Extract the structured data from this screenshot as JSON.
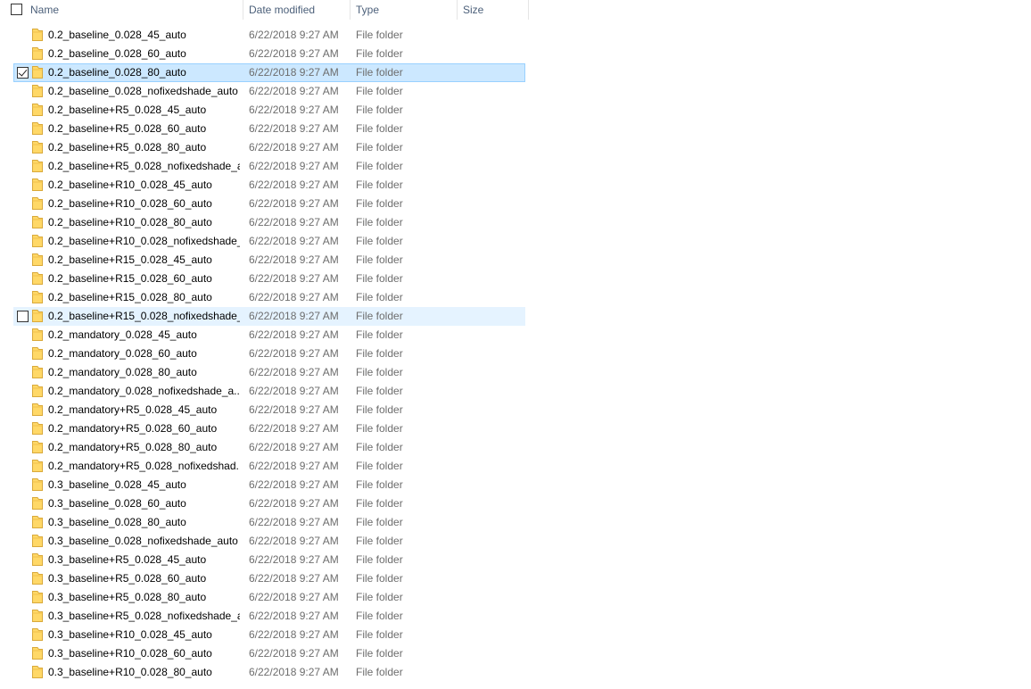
{
  "header": {
    "name_label": "Name",
    "date_label": "Date modified",
    "type_label": "Type",
    "size_label": "Size"
  },
  "rows": [
    {
      "name": "0.2_baseline_0.028_45_auto",
      "date": "6/22/2018 9:27 AM",
      "type": "File folder",
      "state": ""
    },
    {
      "name": "0.2_baseline_0.028_60_auto",
      "date": "6/22/2018 9:27 AM",
      "type": "File folder",
      "state": ""
    },
    {
      "name": "0.2_baseline_0.028_80_auto",
      "date": "6/22/2018 9:27 AM",
      "type": "File folder",
      "state": "selected"
    },
    {
      "name": "0.2_baseline_0.028_nofixedshade_auto",
      "date": "6/22/2018 9:27 AM",
      "type": "File folder",
      "state": ""
    },
    {
      "name": "0.2_baseline+R5_0.028_45_auto",
      "date": "6/22/2018 9:27 AM",
      "type": "File folder",
      "state": ""
    },
    {
      "name": "0.2_baseline+R5_0.028_60_auto",
      "date": "6/22/2018 9:27 AM",
      "type": "File folder",
      "state": ""
    },
    {
      "name": "0.2_baseline+R5_0.028_80_auto",
      "date": "6/22/2018 9:27 AM",
      "type": "File folder",
      "state": ""
    },
    {
      "name": "0.2_baseline+R5_0.028_nofixedshade_a...",
      "date": "6/22/2018 9:27 AM",
      "type": "File folder",
      "state": ""
    },
    {
      "name": "0.2_baseline+R10_0.028_45_auto",
      "date": "6/22/2018 9:27 AM",
      "type": "File folder",
      "state": ""
    },
    {
      "name": "0.2_baseline+R10_0.028_60_auto",
      "date": "6/22/2018 9:27 AM",
      "type": "File folder",
      "state": ""
    },
    {
      "name": "0.2_baseline+R10_0.028_80_auto",
      "date": "6/22/2018 9:27 AM",
      "type": "File folder",
      "state": ""
    },
    {
      "name": "0.2_baseline+R10_0.028_nofixedshade_...",
      "date": "6/22/2018 9:27 AM",
      "type": "File folder",
      "state": ""
    },
    {
      "name": "0.2_baseline+R15_0.028_45_auto",
      "date": "6/22/2018 9:27 AM",
      "type": "File folder",
      "state": ""
    },
    {
      "name": "0.2_baseline+R15_0.028_60_auto",
      "date": "6/22/2018 9:27 AM",
      "type": "File folder",
      "state": ""
    },
    {
      "name": "0.2_baseline+R15_0.028_80_auto",
      "date": "6/22/2018 9:27 AM",
      "type": "File folder",
      "state": ""
    },
    {
      "name": "0.2_baseline+R15_0.028_nofixedshade_...",
      "date": "6/22/2018 9:27 AM",
      "type": "File folder",
      "state": "hover"
    },
    {
      "name": "0.2_mandatory_0.028_45_auto",
      "date": "6/22/2018 9:27 AM",
      "type": "File folder",
      "state": ""
    },
    {
      "name": "0.2_mandatory_0.028_60_auto",
      "date": "6/22/2018 9:27 AM",
      "type": "File folder",
      "state": ""
    },
    {
      "name": "0.2_mandatory_0.028_80_auto",
      "date": "6/22/2018 9:27 AM",
      "type": "File folder",
      "state": ""
    },
    {
      "name": "0.2_mandatory_0.028_nofixedshade_a...",
      "date": "6/22/2018 9:27 AM",
      "type": "File folder",
      "state": ""
    },
    {
      "name": "0.2_mandatory+R5_0.028_45_auto",
      "date": "6/22/2018 9:27 AM",
      "type": "File folder",
      "state": ""
    },
    {
      "name": "0.2_mandatory+R5_0.028_60_auto",
      "date": "6/22/2018 9:27 AM",
      "type": "File folder",
      "state": ""
    },
    {
      "name": "0.2_mandatory+R5_0.028_80_auto",
      "date": "6/22/2018 9:27 AM",
      "type": "File folder",
      "state": ""
    },
    {
      "name": "0.2_mandatory+R5_0.028_nofixedshad...",
      "date": "6/22/2018 9:27 AM",
      "type": "File folder",
      "state": ""
    },
    {
      "name": "0.3_baseline_0.028_45_auto",
      "date": "6/22/2018 9:27 AM",
      "type": "File folder",
      "state": ""
    },
    {
      "name": "0.3_baseline_0.028_60_auto",
      "date": "6/22/2018 9:27 AM",
      "type": "File folder",
      "state": ""
    },
    {
      "name": "0.3_baseline_0.028_80_auto",
      "date": "6/22/2018 9:27 AM",
      "type": "File folder",
      "state": ""
    },
    {
      "name": "0.3_baseline_0.028_nofixedshade_auto",
      "date": "6/22/2018 9:27 AM",
      "type": "File folder",
      "state": ""
    },
    {
      "name": "0.3_baseline+R5_0.028_45_auto",
      "date": "6/22/2018 9:27 AM",
      "type": "File folder",
      "state": ""
    },
    {
      "name": "0.3_baseline+R5_0.028_60_auto",
      "date": "6/22/2018 9:27 AM",
      "type": "File folder",
      "state": ""
    },
    {
      "name": "0.3_baseline+R5_0.028_80_auto",
      "date": "6/22/2018 9:27 AM",
      "type": "File folder",
      "state": ""
    },
    {
      "name": "0.3_baseline+R5_0.028_nofixedshade_a...",
      "date": "6/22/2018 9:27 AM",
      "type": "File folder",
      "state": ""
    },
    {
      "name": "0.3_baseline+R10_0.028_45_auto",
      "date": "6/22/2018 9:27 AM",
      "type": "File folder",
      "state": ""
    },
    {
      "name": "0.3_baseline+R10_0.028_60_auto",
      "date": "6/22/2018 9:27 AM",
      "type": "File folder",
      "state": ""
    },
    {
      "name": "0.3_baseline+R10_0.028_80_auto",
      "date": "6/22/2018 9:27 AM",
      "type": "File folder",
      "state": ""
    }
  ],
  "colors": {
    "selected_bg": "#cce8ff",
    "selected_border": "#99d1ff",
    "hover_bg": "#e5f3ff",
    "folder_yellow": "#ffd867",
    "header_text": "#4c607a"
  },
  "icons": {
    "folder": "folder-icon",
    "checkbox": "checkbox-icon"
  }
}
